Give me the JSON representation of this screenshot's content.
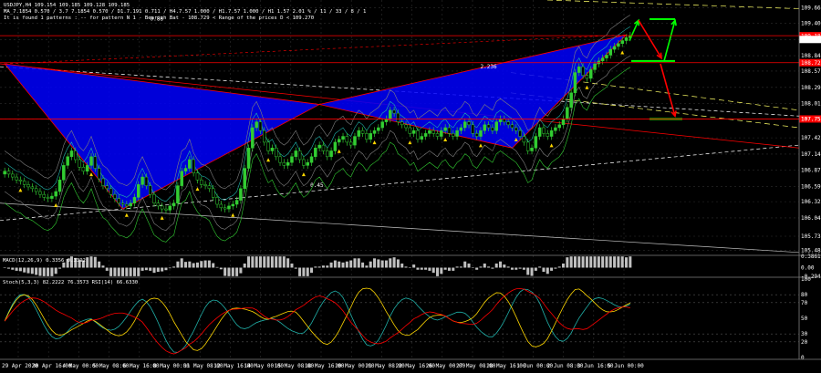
{
  "header": {
    "line1": "USDJPY,H4  109.154 109.185 109.128 109.185",
    "line2": "MA_7.1854   0.570 / 3.7 7.1854    0.570 / D1.7.191  0.711 /   H4.7.57  1.000 /  H1.7.57  1.000 /  H1 1.57   2.01 % /  11 / 33 / 8 / 1",
    "line3": "It is found 1 patterns :  -- for pattern N 1 - Bearish Bat - 108.729 < Range of the prices D < 109.270"
  },
  "colors": {
    "background": "#000000",
    "grid": "#2e2e2e",
    "bull_candle": "#32cd32",
    "bear_candle": "#000000",
    "candle_outline": "#32cd32",
    "pattern_fill": "#0000ff",
    "pattern_line": "#ff0000",
    "arrow_green": "#00ff00",
    "arrow_red": "#ff0000",
    "level_line": "#ff0000",
    "macd_hist": "#c0c0c0",
    "stoch_main": "#20b2aa",
    "stoch_signal": "#ffd700",
    "rsi": "#ff0000",
    "envelope": "#ffffff"
  },
  "chart_data": {
    "type": "candlestick",
    "symbol": "USDJPY",
    "timeframe": "H4",
    "price_axis": {
      "ticks": [
        "109.665",
        "109.400",
        "109.120",
        "108.840",
        "108.575",
        "108.295",
        "108.015",
        "107.750",
        "107.425",
        "107.145",
        "106.870",
        "106.590",
        "106.325",
        "106.045",
        "105.730",
        "105.485"
      ],
      "ylim": [
        105.4,
        109.8
      ]
    },
    "price_labels": [
      {
        "value": 109.185,
        "text": "109.185",
        "bg": "#ff0000"
      },
      {
        "value": 109.12,
        "text": "109.120",
        "bg": "#ffffff"
      },
      {
        "value": 108.72,
        "text": "108.720",
        "bg": "#ff0000"
      },
      {
        "value": 107.75,
        "text": "107.750",
        "bg": "#ff0000"
      }
    ],
    "time_labels": [
      "29 Apr 2020",
      "30 Apr 16:00",
      "4 May 00:00",
      "5 May 08:00",
      "6 May 16:00",
      "8 May 00:00",
      "11 May 08:00",
      "12 May 16:00",
      "14 May 00:00",
      "15 May 08:00",
      "18 May 16:00",
      "20 May 00:00",
      "21 May 08:00",
      "22 May 16:00",
      "26 May 00:00",
      "27 May 08:00",
      "28 May 16:00",
      "1 Jun 00:00",
      "2 Jun 08:00",
      "3 Jun 16:00",
      "5 Jun 00:00"
    ],
    "candles_close": [
      106.85,
      106.8,
      106.75,
      106.7,
      106.68,
      106.62,
      106.58,
      106.55,
      106.5,
      106.45,
      106.4,
      106.38,
      106.42,
      106.5,
      106.7,
      106.95,
      107.1,
      107.2,
      107.05,
      106.92,
      106.85,
      106.95,
      107.1,
      106.9,
      106.72,
      106.6,
      106.55,
      106.45,
      106.38,
      106.3,
      106.28,
      106.25,
      106.3,
      106.4,
      106.62,
      106.75,
      106.6,
      106.45,
      106.3,
      106.25,
      106.2,
      106.18,
      106.25,
      106.3,
      106.6,
      106.85,
      106.9,
      107.05,
      106.82,
      106.7,
      106.62,
      106.6,
      106.55,
      106.4,
      106.28,
      106.22,
      106.2,
      106.25,
      106.28,
      106.35,
      106.55,
      106.9,
      107.25,
      107.6,
      107.7,
      107.55,
      107.35,
      107.2,
      107.25,
      107.1,
      107.0,
      106.95,
      107.0,
      107.1,
      107.2,
      107.05,
      106.95,
      107.0,
      107.1,
      107.25,
      107.3,
      107.2,
      107.1,
      107.2,
      107.35,
      107.4,
      107.45,
      107.35,
      107.3,
      107.45,
      107.55,
      107.5,
      107.4,
      107.5,
      107.55,
      107.6,
      107.7,
      107.75,
      107.9,
      107.85,
      107.7,
      107.65,
      107.6,
      107.5,
      107.55,
      107.4,
      107.45,
      107.5,
      107.55,
      107.5,
      107.45,
      107.55,
      107.6,
      107.5,
      107.45,
      107.55,
      107.6,
      107.7,
      107.65,
      107.5,
      107.45,
      107.55,
      107.65,
      107.6,
      107.55,
      107.7,
      107.75,
      107.7,
      107.65,
      107.6,
      107.55,
      107.45,
      107.35,
      107.2,
      107.25,
      107.45,
      107.6,
      107.5,
      107.45,
      107.55,
      107.6,
      107.65,
      107.75,
      107.95,
      108.2,
      108.55,
      108.65,
      108.5,
      108.45,
      108.6,
      108.7,
      108.75,
      108.8,
      108.85,
      108.95,
      109.0,
      109.05,
      109.1,
      109.15,
      109.19
    ],
    "pattern": {
      "name": "Bearish Bat",
      "fib_labels": [
        "2.236",
        "0.45",
        "0.88"
      ],
      "range_low": 108.729,
      "range_high": 109.27
    },
    "macd": {
      "label": "MACD(12,26,9) 0.3356 0.3392",
      "ticks": [
        "0.3861",
        "0.00",
        "-0.294"
      ]
    },
    "stoch": {
      "label": "Stoch(5,3,3) 82.2222 76.3573  RSI(14) 66.6330",
      "ticks": [
        "100",
        "80",
        "70",
        "50",
        "30",
        "20",
        "0"
      ]
    }
  }
}
